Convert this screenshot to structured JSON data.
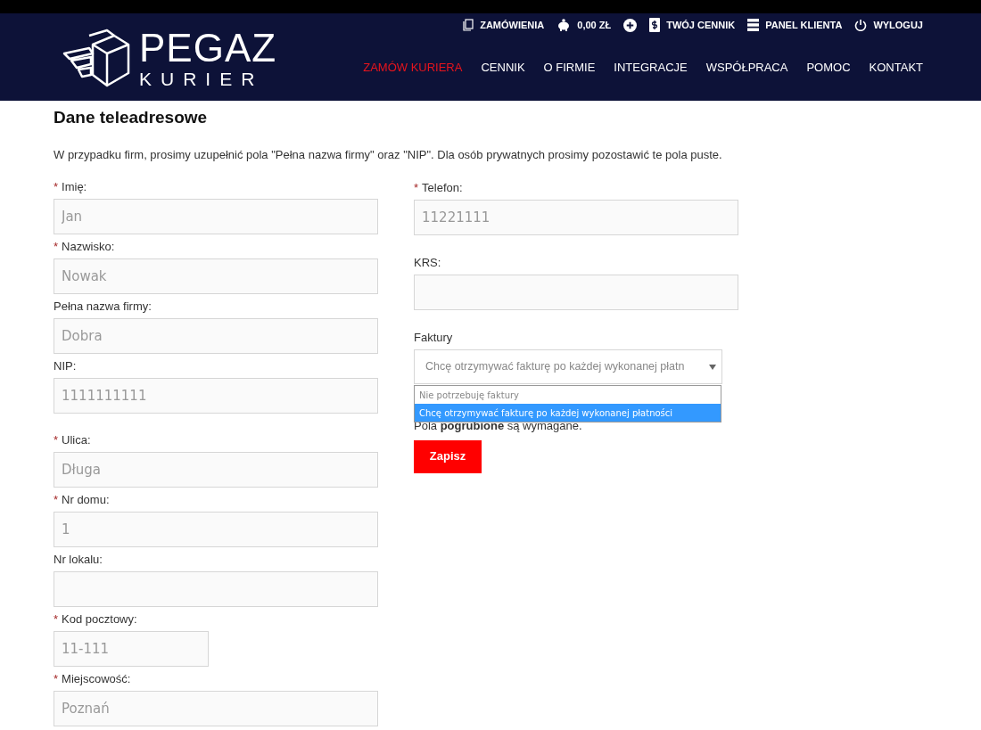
{
  "header": {
    "logo": {
      "title": "PEGAZ",
      "subtitle": "KURIER"
    },
    "top_links": [
      {
        "kind": "orders",
        "label": "ZAMÓWIENIA"
      },
      {
        "kind": "wallet",
        "label": "0,00 ZŁ"
      },
      {
        "kind": "add"
      },
      {
        "kind": "pricelist",
        "label": "TWÓJ CENNIK"
      },
      {
        "kind": "panel",
        "label": "PANEL KLIENTA"
      },
      {
        "kind": "logout",
        "label": "WYLOGUJ"
      }
    ],
    "nav": [
      {
        "label": "ZAMÓW KURIERA",
        "selected": true
      },
      {
        "label": "CENNIK",
        "selected": false
      },
      {
        "label": "O FIRMIE",
        "selected": false
      },
      {
        "label": "INTEGRACJE",
        "selected": false
      },
      {
        "label": "WSPÓŁPRACA",
        "selected": false
      },
      {
        "label": "POMOC",
        "selected": false
      },
      {
        "label": "KONTAKT",
        "selected": false
      }
    ]
  },
  "title": "Dane teleadresowe",
  "intro": "W przypadku firm, prosimy uzupełnić pola \"Pełna nazwa firmy\" oraz \"NIP\". Dla osób prywatnych prosimy pozostawić te pola puste.",
  "left_fields": [
    {
      "marker": "*",
      "label": "Imię:",
      "value": "Jan",
      "kind": "full"
    },
    {
      "marker": "*",
      "label": "Nazwisko:",
      "value": "Nowak",
      "kind": "full"
    },
    {
      "label": "Pełna nazwa firmy:",
      "value": "Dobra",
      "kind": "full"
    },
    {
      "label": "NIP:",
      "value": "1111111111",
      "kind": "full"
    }
  ],
  "address_fields": [
    {
      "marker": "*",
      "label": "Ulica:",
      "value": "Długa",
      "kind": "full"
    },
    {
      "marker": "*",
      "label": "Nr domu:",
      "value": "1",
      "kind": "full"
    },
    {
      "label": "Nr lokalu:",
      "kind": "full"
    },
    {
      "marker": "*",
      "label": "Kod pocztowy:",
      "value": "11-111",
      "kind": "short"
    },
    {
      "marker": "*",
      "label": "Miejscowość:",
      "value": "Poznań",
      "kind": "full"
    }
  ],
  "right_fields": [
    {
      "marker": "*",
      "label": "Telefon:",
      "value": "11221111",
      "kind": "full"
    },
    {
      "label": "KRS:",
      "kind": "full"
    }
  ],
  "invoice": {
    "label": "Faktury",
    "value": "Chcę otrzymywać fakturę po każdej wykonanej płatn",
    "options": [
      {
        "label": "Nie potrzebuję faktury",
        "selected": false
      },
      {
        "label": "Chcę otrzymywać fakturę po każdej wykonanej płatności",
        "selected": true
      }
    ]
  },
  "required_note": "Pola **pogrubione** są wymagane.",
  "save_button": "Zapisz"
}
